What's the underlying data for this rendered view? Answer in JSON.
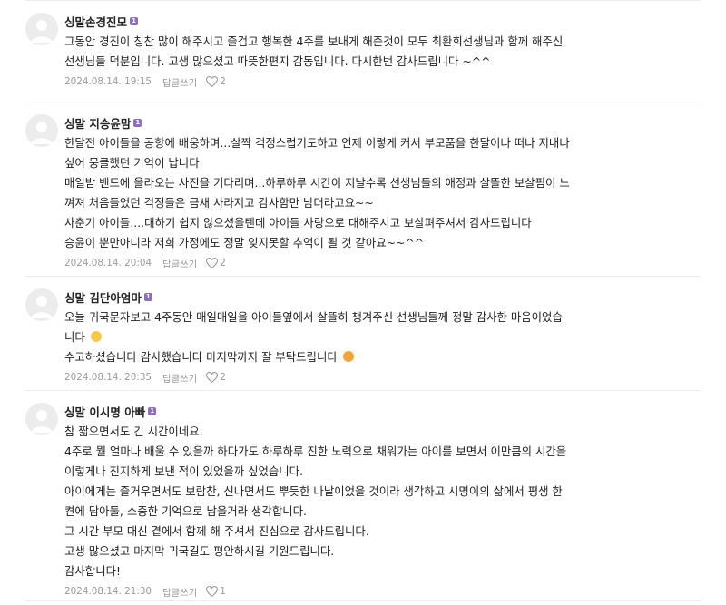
{
  "comments": [
    {
      "author": "싱말손경진모",
      "badge": "1",
      "lines": [
        "그동안 경진이 칭찬 많이 해주시고 즐겁고 행복한 4주를 보내게 해준것이 모두 최환희선생님과 함께 해주신",
        "선생님들 덕분입니다. 고생 많으셨고 따뜻한편지 감동입니다. 다시한번 감사드립니다 ~^^"
      ],
      "date": "2024.08.14. 19:15",
      "reply_label": "답글쓰기",
      "likes": "2"
    },
    {
      "author": "싱말 지승윤맘",
      "badge": "1",
      "lines": [
        "한달전 아이들을 공항에 배웅하며...살짝 걱정스럽기도하고 언제 이렇게 커서 부모품을 한달이나 떠나 지내나",
        "싶어 뭉클했던 기억이 납니다",
        "매일밤 밴드에 올라오는 사진을 기다리며...하루하루 시간이 지날수록 선생님들의 애정과 살뜰한 보살핌이 느",
        "껴져 처음들었던 걱정들은 금새 사라지고 감사함만 남더라고요~~",
        "사춘기 아이들....대하기 쉽지 않으셨을텐데 아이들 사랑으로 대해주시고 보살펴주셔서 감사드립니다",
        "승윤이 뿐만아니라 저희 가정에도 정말 잊지못할 추억이 될 것 같아요~~^^"
      ],
      "date": "2024.08.14. 20:04",
      "reply_label": "답글쓰기",
      "likes": "2"
    },
    {
      "author": "싱말 김단아엄마",
      "badge": "1",
      "lines": [
        "오늘 귀국문자보고 4주동안 매일매일을 아이들옆에서 살뜰히 챙겨주신 선생님들께 정말 감사한 마음이었습",
        "니다",
        "수고하셨습니다 감사했습니다 마지막까지 잘 부탁드립니다"
      ],
      "date": "2024.08.14. 20:35",
      "reply_label": "답글쓰기",
      "likes": "2"
    },
    {
      "author": "싱말 이시명 아빠",
      "badge": "1",
      "lines": [
        "참 짧으면서도 긴 시간이네요.",
        "4주로 뭘 얼마나 배울 수 있을까 하다가도 하루하루 진한 노력으로 채워가는 아이를 보면서 이만큼의 시간을",
        "이렇게나 진지하게 보낸 적이 있었을까 싶었습니다.",
        "아이에게는 즐거우면서도 보람찬, 신나면서도 뿌듯한 나날이었을 것이라 생각하고 시명이의 삶에서 평생 한",
        "켠에 담아둘, 소중한 기억으로 남을거라 생각합니다.",
        "그 시간 부모 대신 곁에서 함께 해 주셔서 진심으로 감사드립니다.",
        "고생 많으셨고 마지막 귀국길도 평안하시길 기원드립니다.",
        "감사합니다!"
      ],
      "date": "2024.08.14. 21:30",
      "reply_label": "답글쓰기",
      "likes": "1"
    }
  ],
  "icons": {
    "avatar": "default-profile-icon",
    "badge": "member-level-badge-icon",
    "like": "heart-outline-icon",
    "emoji_1": "hand-heart-emoji-icon",
    "emoji_2": "crying-face-emoji-icon"
  },
  "colors": {
    "badge": "#8e6fbf",
    "meta": "#9b9b9b",
    "divider": "#ebebeb"
  }
}
